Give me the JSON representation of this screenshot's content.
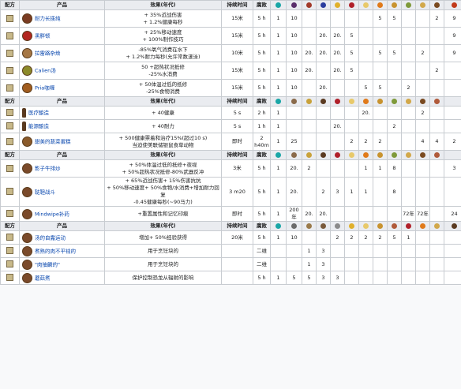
{
  "headers": {
    "recipe": "配方",
    "product": "产品",
    "effect": "效果(年代)",
    "duration": "持续时间",
    "spoil": "腐败"
  },
  "colors": {
    "link": "#0645ad",
    "header_bg": "#eaecf0",
    "border": "#c8ccd1"
  },
  "header_icons_1": [
    "water-drop-icon",
    "grapes-icon",
    "pepper-icon",
    "blueberry-icon",
    "flower-icon",
    "cherry-icon",
    "egg-icon",
    "carrot-icon",
    "bread-icon",
    "leaf-icon",
    "grain-icon",
    "cocoa-icon",
    "pepper-red-icon"
  ],
  "header_icons_2": [
    "water-drop-icon",
    "bone-icon",
    "herb-icon",
    "bean-icon",
    "cherry-icon",
    "egg-icon",
    "carrot-icon",
    "bread-icon",
    "leaf-icon",
    "grain-icon",
    "cocoa-icon",
    "meat-icon"
  ],
  "header_icons_3": [
    "water-drop-icon",
    "bone-icon",
    "herb-icon",
    "bean-icon",
    "cherry-icon",
    "egg-icon",
    "carrot-icon",
    "bread-icon",
    "leaf-icon",
    "grain-icon",
    "cocoa-icon",
    "meat-icon"
  ],
  "header_icons_4": [
    "water-drop-icon",
    "rock-icon",
    "stick-icon",
    "mushroom-icon",
    "axe-icon",
    "flower-icon",
    "egg-icon",
    "bread-icon",
    "meat-icon",
    "cherry-icon",
    "carrot-icon",
    "grain-icon",
    "bean-icon"
  ],
  "section1": [
    {
      "name": "耐力长拨纯",
      "dish": "#7a3b22",
      "e1": "+ 35%近战伤害",
      "e2": "+ 1.2%健康每秒",
      "dur": "15米",
      "spoil": "5 h",
      "c": [
        "1",
        "10",
        "",
        "",
        "",
        "",
        "",
        "5",
        "5",
        "",
        "",
        "2",
        "9"
      ]
    },
    {
      "name": "黑胖顿",
      "dish": "#b2261f",
      "e1": "+ 25%移动速度",
      "e2": "+ 100%制作技巧",
      "dur": "15米",
      "spoil": "5 h",
      "c": [
        "1",
        "10",
        "",
        "20.",
        "20.",
        "5",
        "",
        "",
        "",
        "",
        "",
        "",
        "9"
      ]
    },
    {
      "name": "拉雷路杂烩",
      "dish": "#a67744",
      "e1": "-85%氧气消费在水下",
      "e2": "+ 1.2%耐力每秒(允许常数漾泳)",
      "dur": "10米",
      "spoil": "5 h",
      "c": [
        "1",
        "10",
        "20.",
        "20.",
        "20.",
        "5",
        "",
        "5",
        "5",
        "",
        "2",
        "",
        "9"
      ]
    },
    {
      "name": "Calien汤",
      "dish": "#8c8a2a",
      "e1": "50 +超热状况抵修",
      "e2": "-25%水消费",
      "dur": "15米",
      "spoil": "5 h",
      "c": [
        "1",
        "10",
        "20.",
        "",
        "20.",
        "5",
        "",
        "",
        "",
        "",
        "",
        "2",
        ""
      ]
    },
    {
      "name": "Pria咖喱",
      "dish": "#a15d1f",
      "e1": "+ 50体温过低的抵修",
      "e2": "-25%食物消费",
      "dur": "15米",
      "spoil": "5 h",
      "c": [
        "1",
        "10",
        "",
        "20.",
        "",
        "",
        "5",
        "5",
        "",
        "2",
        "",
        "",
        ""
      ]
    }
  ],
  "section2": [
    {
      "name": "医疗酿造",
      "e1": "+ 40健康",
      "dur": "5 s",
      "spoil": "2 h",
      "c": [
        "1",
        "",
        "",
        "",
        "",
        "",
        "20.",
        "",
        "",
        "",
        "2",
        "",
        ""
      ]
    },
    {
      "name": "能源酿造",
      "e1": "+ 40耐力",
      "dur": "5 s",
      "spoil": "1 h",
      "c": [
        "1",
        "",
        "",
        "",
        "20.",
        "",
        "",
        "",
        "2",
        "",
        "",
        "",
        ""
      ]
    },
    {
      "name": "甜美的蔬菜蛋糕",
      "e1": "+ 500健康票着和治疗15%(超过10 s)",
      "e2": "当迫使美联储银鼠食草动物",
      "dur": "即时",
      "spoil": "2 h40m",
      "c": [
        "1",
        "25",
        "",
        "",
        "",
        "2",
        "2",
        "2",
        "",
        "",
        "4",
        "4",
        "2"
      ]
    }
  ],
  "section3": [
    {
      "name": "影子牛排炒",
      "e1": "+ 50%体温过低的抵修+夜视",
      "e2": "+ 50%超热状况抵修-80%武器反冲",
      "dur": "3米",
      "spoil": "5 h",
      "c": [
        "1",
        "20.",
        "2",
        "",
        "",
        "",
        "1",
        "1",
        "8",
        "",
        "",
        "",
        "3"
      ]
    },
    {
      "name": "鞑靼战斗",
      "e1": "+ 65%近战伤害+ 15%伤害抗抗",
      "e2": "+ 50%移动速度+ 50%食物/水消费+增加耐力回复",
      "e3": "-0.45健康每秒(~90马力)",
      "dur": "3 m20",
      "spoil": "5 h",
      "c": [
        "1",
        "20.",
        "",
        "2",
        "3",
        "1",
        "1",
        "",
        "8",
        "",
        "",
        "",
        ""
      ]
    },
    {
      "name": "Mindwipe补药",
      "e1": "+重置属性和记忆印痕",
      "dur": "即时",
      "spoil": "5 h",
      "c": [
        "1",
        "200年",
        "20.",
        "20.",
        "",
        "",
        "",
        "",
        "",
        "72年",
        "72年",
        "",
        "24"
      ]
    }
  ],
  "section4": [
    {
      "name": "汤的自露运动",
      "e1": "增加+ 50%经验获得",
      "dur": "20米",
      "spoil": "5 h",
      "c": [
        "1",
        "10",
        "",
        "",
        "2",
        "2",
        "2",
        "2",
        "5",
        "1",
        "",
        ""
      ]
    },
    {
      "name": "煮熟的肉不平钱的",
      "e1": "用于烹饪块的",
      "dur": "",
      "spoil": "二维",
      "c": [
        "",
        "",
        "1",
        "3",
        "",
        "",
        "",
        "",
        "",
        "",
        "",
        ""
      ]
    },
    {
      "name": "\"肉抽麟的\"",
      "e1": "用于烹饪块的",
      "dur": "",
      "spoil": "二维",
      "c": [
        "",
        "",
        "1",
        "3",
        "",
        "",
        "",
        "",
        "",
        "",
        "",
        ""
      ]
    },
    {
      "name": "蘑菇煮",
      "e1": "保护控制恐龙从辐射的影响",
      "dur": "",
      "spoil": "5 h",
      "c": [
        "1",
        "5",
        "5",
        "3",
        "3",
        "",
        "",
        "",
        "",
        "",
        "",
        "",
        ""
      ]
    }
  ]
}
